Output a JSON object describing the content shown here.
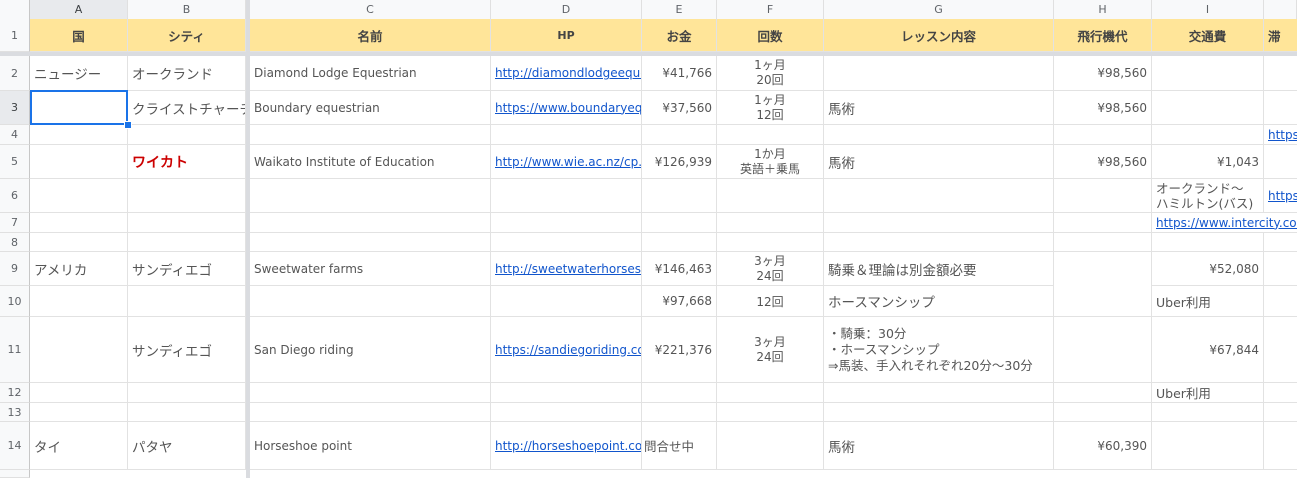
{
  "columns": [
    "A",
    "B",
    "C",
    "D",
    "E",
    "F",
    "G",
    "H",
    "I"
  ],
  "rows": [
    "1",
    "2",
    "3",
    "4",
    "5",
    "6",
    "7",
    "8",
    "9",
    "10",
    "11",
    "12",
    "13",
    "14"
  ],
  "header": {
    "country": "国",
    "city": "シティ",
    "name": "名前",
    "hp": "HP",
    "price": "お金",
    "count": "回数",
    "lesson": "レッスン内容",
    "flight": "飛行機代",
    "transport": "交通費",
    "next_partial": "滞"
  },
  "r2": {
    "country": "ニュージー",
    "city": "オークランド",
    "name": "Diamond Lodge Equestrian",
    "hp": "http://diamondlodgeeque",
    "price": "¥41,766",
    "count_line1": "1ヶ月",
    "count_line2": "20回",
    "flight": "¥98,560"
  },
  "r3": {
    "city": "クライストチャーチ",
    "name": "Boundary equestrian",
    "hp": "https://www.boundaryequ",
    "price": "¥37,560",
    "count_line1": "1ヶ月",
    "count_line2": "12回",
    "lesson": "馬術",
    "flight": "¥98,560"
  },
  "r4": {
    "next": "https:"
  },
  "r5": {
    "city": "ワイカト",
    "name": "Waikato Institute of Education",
    "hp": "http://www.wie.ac.nz/cp.h",
    "price": "¥126,939",
    "count_line1": "1か月",
    "count_line2": "英語＋乗馬",
    "lesson": "馬術",
    "flight": "¥98,560",
    "transport": "¥1,043"
  },
  "r6": {
    "transport_line1": "オークランド～",
    "transport_line2": "ハミルトン(バス)",
    "next": "https:"
  },
  "r7": {
    "transport": "https://www.intercity.co.n"
  },
  "r9": {
    "country": "アメリカ",
    "city": "サンディエゴ",
    "name": "Sweetwater farms",
    "hp": "http://sweetwaterhorses.c",
    "price": "¥146,463",
    "count_line1": "3ヶ月",
    "count_line2": "24回",
    "lesson": "騎乗＆理論は別金額必要",
    "transport": "¥52,080"
  },
  "r10": {
    "price": "¥97,668",
    "count": "12回",
    "lesson": "ホースマンシップ",
    "transport": "Uber利用"
  },
  "r11": {
    "city": "サンディエゴ",
    "name": "San Diego riding",
    "hp": "https://sandiegoriding.com",
    "price": "¥221,376",
    "count_line1": "3ヶ月",
    "count_line2": "24回",
    "lesson_line1": "・騎乗：30分",
    "lesson_line2": "・ホースマンシップ",
    "lesson_line3": "⇒馬装、手入れそれぞれ20分～30分",
    "transport": "¥67,844"
  },
  "r12": {
    "transport": "Uber利用"
  },
  "r14": {
    "country": "タイ",
    "city": "パタヤ",
    "name": "Horseshoe point",
    "hp": "http://horseshoepoint.com",
    "price": "問合せ中",
    "lesson": "馬術",
    "flight": "¥60,390"
  }
}
